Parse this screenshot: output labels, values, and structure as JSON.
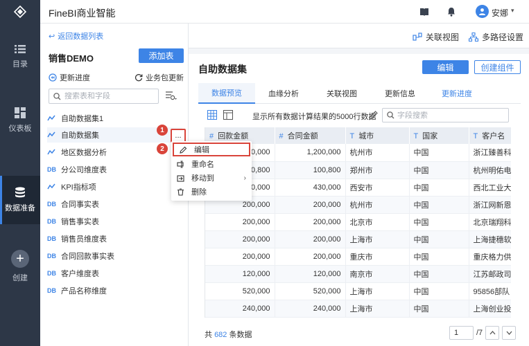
{
  "app": {
    "title": "FineBI商业智能",
    "user_name": "安娜",
    "accent": "#3d84e6",
    "dark_nav": "#2d3747",
    "highlight": "#d9443a"
  },
  "left_nav": [
    {
      "label": "目录",
      "icon": "list-icon"
    },
    {
      "label": "仪表板",
      "icon": "dashboard-icon"
    },
    {
      "label": "数据准备",
      "icon": "database-icon",
      "active": true
    },
    {
      "label": "创建",
      "icon": "plus-icon"
    }
  ],
  "list_panel": {
    "back_label": "返回数据列表",
    "package_title": "销售DEMO",
    "add_table_label": "添加表",
    "update_progress_label": "更新进度",
    "biz_update_label": "业务包更新",
    "search_placeholder": "搜索表和字段",
    "tables": [
      {
        "icon": "~",
        "label": "自助数据集1"
      },
      {
        "icon": "~",
        "label": "自助数据集"
      },
      {
        "icon": "~",
        "label": "地区数据分析"
      },
      {
        "icon": "DB",
        "label": "分公司维度表"
      },
      {
        "icon": "~",
        "label": "KPI指标项"
      },
      {
        "icon": "DB",
        "label": "合同事实表"
      },
      {
        "icon": "DB",
        "label": "销售事实表"
      },
      {
        "icon": "DB",
        "label": "销售员维度表"
      },
      {
        "icon": "DB",
        "label": "合同回款事实表"
      },
      {
        "icon": "DB",
        "label": "客户维度表"
      },
      {
        "icon": "DB",
        "label": "产品名称维度"
      }
    ],
    "more_label": "..."
  },
  "context_menu": {
    "items": [
      {
        "label": "编辑",
        "icon": "pencil-icon"
      },
      {
        "label": "重命名",
        "icon": "rename-icon"
      },
      {
        "label": "移动到",
        "icon": "move-icon"
      },
      {
        "label": "删除",
        "icon": "trash-icon"
      }
    ],
    "badges": [
      "1",
      "2"
    ]
  },
  "header": {
    "related_view_label": "关联视图",
    "multi_path_label": "多路径设置"
  },
  "main": {
    "title": "自助数据集",
    "edit_label": "编辑",
    "create_component_label": "创建组件",
    "tabs": [
      {
        "label": "数据预览",
        "active": true
      },
      {
        "label": "血缘分析"
      },
      {
        "label": "关联视图"
      },
      {
        "label": "更新信息"
      },
      {
        "label": "更新进度",
        "link": true
      }
    ],
    "preview_note": "显示所有数据计算结果的5000行数据",
    "field_search_placeholder": "字段搜索",
    "columns": [
      {
        "type": "#",
        "label": "回款金额"
      },
      {
        "type": "#",
        "label": "合同金额"
      },
      {
        "type": "T",
        "label": "城市"
      },
      {
        "type": "T",
        "label": "国家"
      },
      {
        "type": "T",
        "label": "客户名"
      }
    ],
    "rows": [
      [
        "200,000",
        "1,200,000",
        "杭州市",
        "中国",
        "浙江臻善科"
      ],
      [
        "100,800",
        "100,800",
        "郑州市",
        "中国",
        "杭州明佑电"
      ],
      [
        "430,000",
        "430,000",
        "西安市",
        "中国",
        "西北工业大"
      ],
      [
        "200,000",
        "200,000",
        "杭州市",
        "中国",
        "浙江网新恩"
      ],
      [
        "200,000",
        "200,000",
        "北京市",
        "中国",
        "北京瑞翔科"
      ],
      [
        "200,000",
        "200,000",
        "上海市",
        "中国",
        "上海捷穗软"
      ],
      [
        "200,000",
        "200,000",
        "重庆市",
        "中国",
        "重庆格力供"
      ],
      [
        "120,000",
        "120,000",
        "南京市",
        "中国",
        "江苏邮政司"
      ],
      [
        "520,000",
        "520,000",
        "上海市",
        "中国",
        "95856部队"
      ],
      [
        "240,000",
        "240,000",
        "上海市",
        "中国",
        "上海创业投"
      ]
    ],
    "footer": {
      "prefix": "共",
      "count": "682",
      "suffix": "条数据",
      "page": "1",
      "page_total": "/7"
    }
  }
}
